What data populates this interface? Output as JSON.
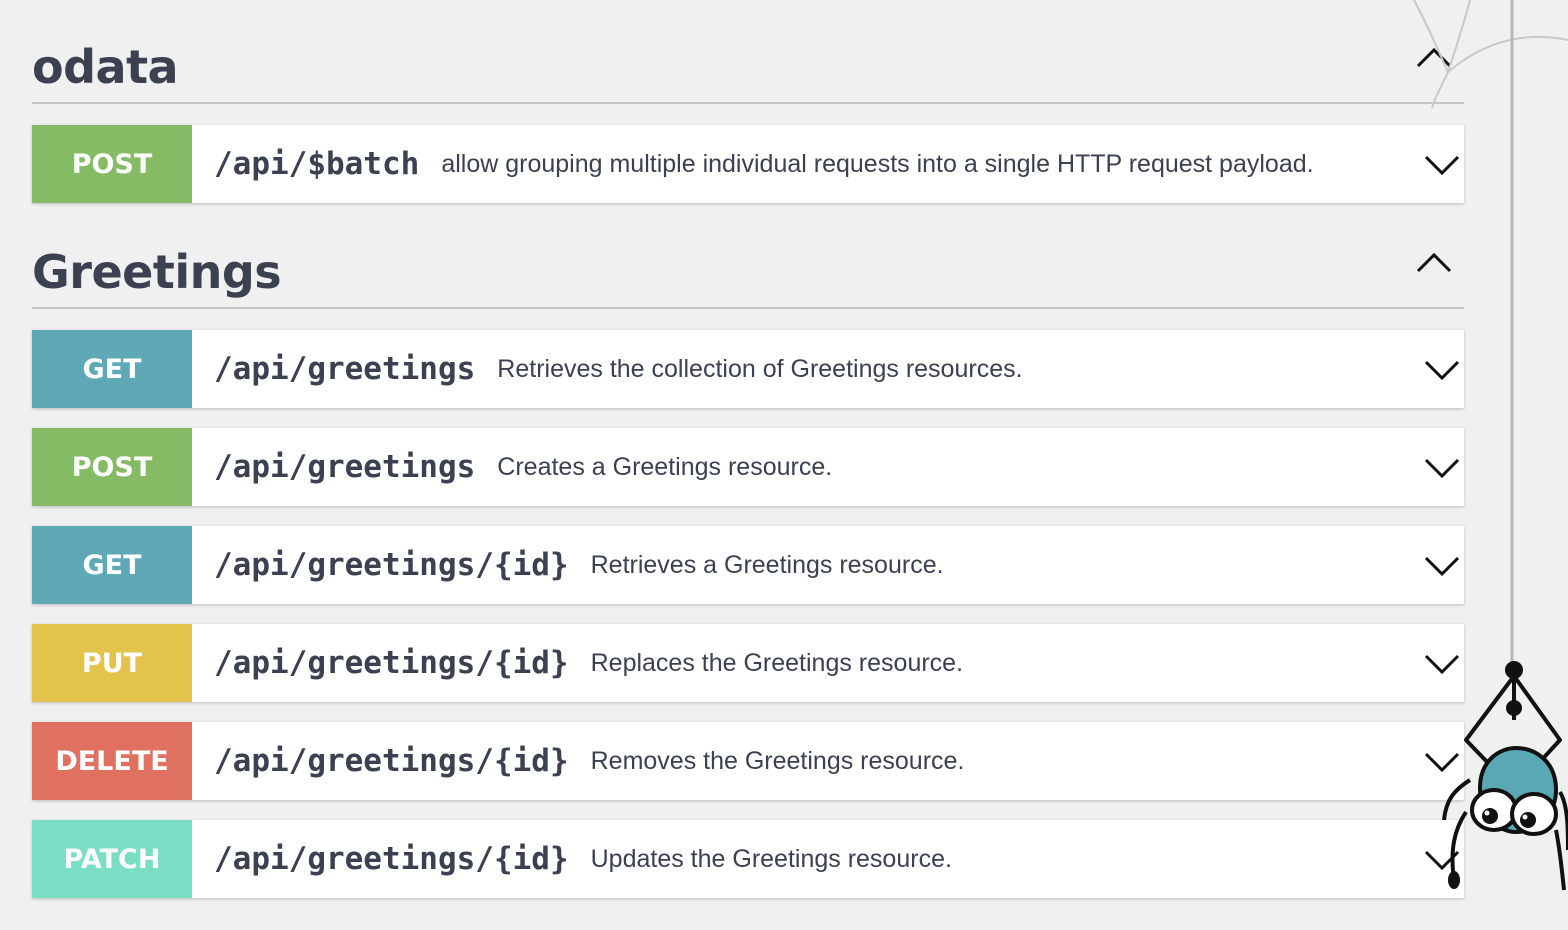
{
  "sections": [
    {
      "title": "odata",
      "operations": [
        {
          "method": "POST",
          "path": "/api/$batch",
          "summary": "allow grouping multiple individual requests into a single HTTP request payload."
        }
      ]
    },
    {
      "title": "Greetings",
      "operations": [
        {
          "method": "GET",
          "path": "/api/greetings",
          "summary": "Retrieves the collection of Greetings resources."
        },
        {
          "method": "POST",
          "path": "/api/greetings",
          "summary": "Creates a Greetings resource."
        },
        {
          "method": "GET",
          "path": "/api/greetings/{id}",
          "summary": "Retrieves a Greetings resource."
        },
        {
          "method": "PUT",
          "path": "/api/greetings/{id}",
          "summary": "Replaces the Greetings resource."
        },
        {
          "method": "DELETE",
          "path": "/api/greetings/{id}",
          "summary": "Removes the Greetings resource."
        },
        {
          "method": "PATCH",
          "path": "/api/greetings/{id}",
          "summary": "Updates the Greetings resource."
        }
      ]
    }
  ],
  "icons": {
    "section_toggle": "chevron-up-icon",
    "operation_toggle": "chevron-down-icon",
    "mascot": "spider-mascot-icon"
  },
  "method_colors": {
    "GET": "#5fa9b7",
    "POST": "#86bb66",
    "PUT": "#e3c34b",
    "DELETE": "#e07060",
    "PATCH": "#79dec4"
  }
}
